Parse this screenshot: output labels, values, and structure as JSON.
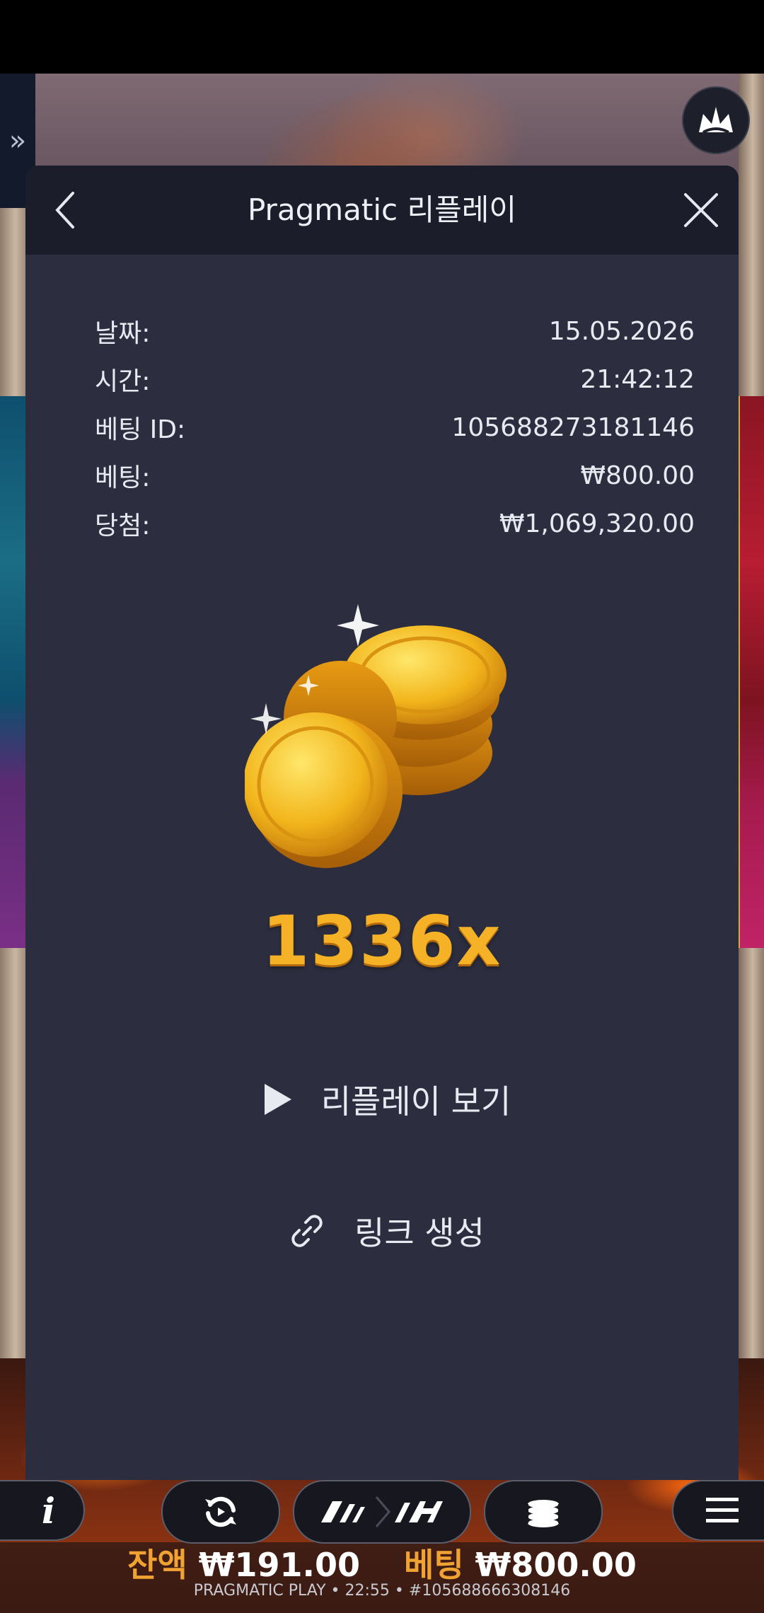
{
  "dialog": {
    "title": "Pragmatic 리플레이",
    "rows": [
      {
        "label": "날짜:",
        "value": "15.05.2026"
      },
      {
        "label": "시간:",
        "value": "21:42:12"
      },
      {
        "label": "베팅 ID:",
        "value": "105688273181146"
      },
      {
        "label": "베팅:",
        "value": "₩800.00"
      },
      {
        "label": "당첨:",
        "value": "₩1,069,320.00"
      }
    ],
    "multiplier": "1336x",
    "replay_label": "리플레이 보기",
    "link_label": "링크 생성"
  },
  "game_bar": {
    "info_label": "i",
    "balance_label": "잔액",
    "balance_value": "₩191.00",
    "bet_label": "베팅",
    "bet_value": "₩800.00",
    "footer_brand": "PRAGMATIC PLAY",
    "footer_time": "22:55",
    "footer_id": "#105688666308146"
  },
  "side": {
    "expand_glyph": "»"
  },
  "colors": {
    "dialog_bg": "#2c2e3f",
    "header_bg": "#1b1d2a",
    "gold": "#f5b226",
    "status_label": "#f0a233"
  }
}
